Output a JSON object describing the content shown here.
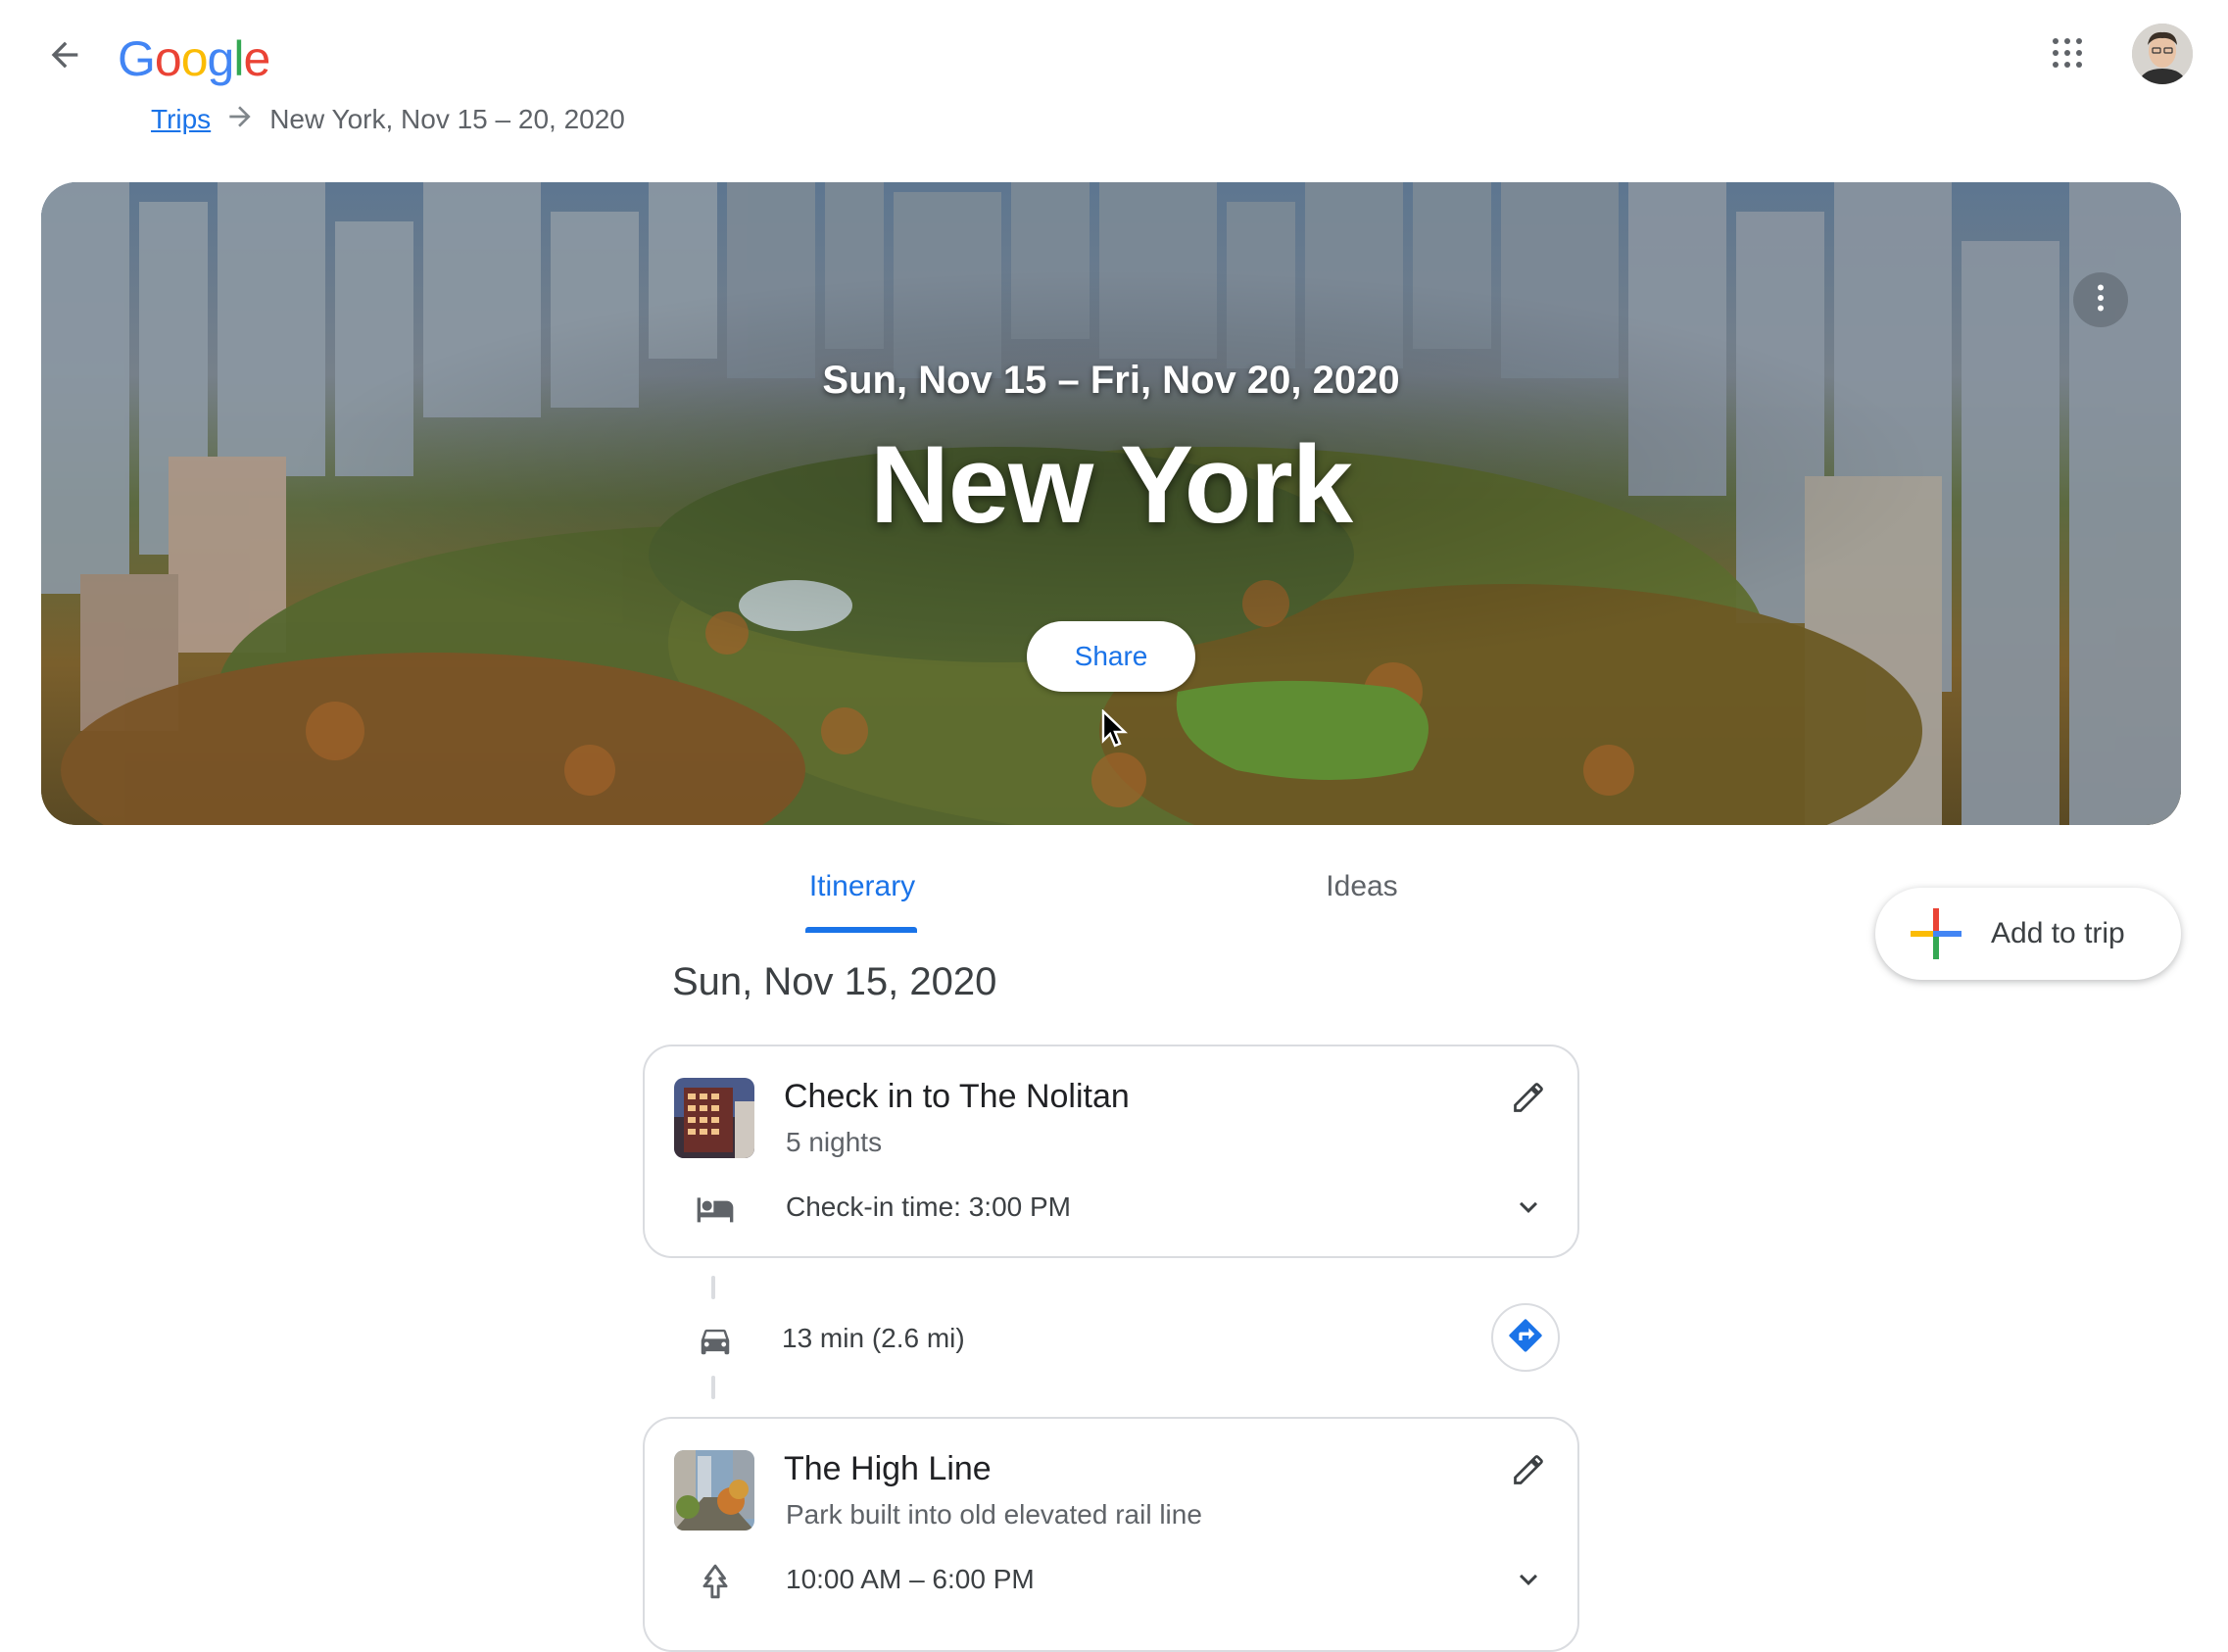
{
  "header": {
    "logo_letters": [
      {
        "char": "G",
        "color": "#4285F4"
      },
      {
        "char": "o",
        "color": "#EA4335"
      },
      {
        "char": "o",
        "color": "#FBBC05"
      },
      {
        "char": "g",
        "color": "#4285F4"
      },
      {
        "char": "l",
        "color": "#34A853"
      },
      {
        "char": "e",
        "color": "#EA4335"
      }
    ],
    "back_icon": "arrow-back-icon",
    "apps_icon": "apps-grid-icon",
    "avatar_icon": "account-avatar"
  },
  "breadcrumb": {
    "root": "Trips",
    "current": "New York, Nov 15 – 20, 2020"
  },
  "hero": {
    "dates": "Sun, Nov 15 – Fri, Nov 20, 2020",
    "title": "New York",
    "share_label": "Share"
  },
  "tabs": [
    {
      "label": "Itinerary",
      "active": true
    },
    {
      "label": "Ideas",
      "active": false
    }
  ],
  "add_to_trip": {
    "label": "Add to trip"
  },
  "day": {
    "heading": "Sun, Nov 15, 2020"
  },
  "items": [
    {
      "title": "Check in to The Nolitan",
      "subtitle": "5 nights",
      "detail": "Check-in time: 3:00 PM",
      "detail_icon": "hotel-bed-icon"
    },
    {
      "title": "The High Line",
      "subtitle": "Park built into old elevated rail line",
      "detail": "10:00 AM – 6:00 PM",
      "detail_icon": "park-tree-icon"
    }
  ],
  "travel": {
    "text": "13 min (2.6 mi)",
    "mode_icon": "car-icon",
    "directions_icon": "directions-icon"
  },
  "colors": {
    "accent": "#1a73e8",
    "text_secondary": "#5f6368",
    "border": "#dadce0"
  }
}
